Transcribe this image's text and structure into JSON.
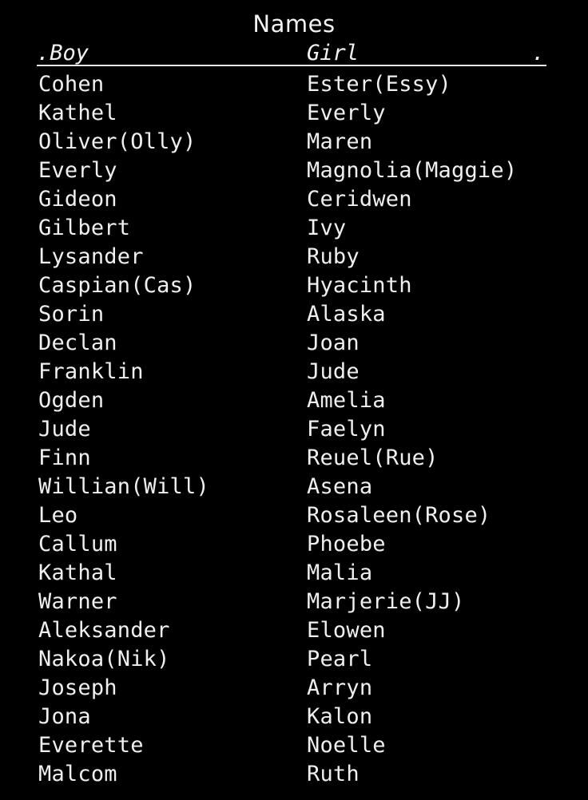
{
  "page": {
    "title": "Names",
    "background_color": "#000000",
    "text_color": "#efefef"
  },
  "table": {
    "headers": {
      "boy": ".Boy",
      "girl": "Girl",
      "trailing_mark": "."
    },
    "rows": [
      {
        "boy": "Cohen",
        "girl": "Ester(Essy)"
      },
      {
        "boy": "Kathel",
        "girl": "Everly"
      },
      {
        "boy": "Oliver(Olly)",
        "girl": "Maren"
      },
      {
        "boy": "Everly",
        "girl": "Magnolia(Maggie)"
      },
      {
        "boy": "Gideon",
        "girl": "Ceridwen"
      },
      {
        "boy": "Gilbert",
        "girl": "Ivy"
      },
      {
        "boy": "Lysander",
        "girl": "Ruby"
      },
      {
        "boy": "Caspian(Cas)",
        "girl": "Hyacinth"
      },
      {
        "boy": "Sorin",
        "girl": "Alaska"
      },
      {
        "boy": "Declan",
        "girl": "Joan"
      },
      {
        "boy": "Franklin",
        "girl": "Jude"
      },
      {
        "boy": "Ogden",
        "girl": "Amelia"
      },
      {
        "boy": "Jude",
        "girl": "Faelyn"
      },
      {
        "boy": "Finn",
        "girl": "Reuel(Rue)"
      },
      {
        "boy": "Willian(Will)",
        "girl": "Asena"
      },
      {
        "boy": "Leo",
        "girl": "Rosaleen(Rose)"
      },
      {
        "boy": "Callum",
        "girl": "Phoebe"
      },
      {
        "boy": "Kathal",
        "girl": "Malia"
      },
      {
        "boy": "Warner",
        "girl": "Marjerie(JJ)"
      },
      {
        "boy": "Aleksander",
        "girl": "Elowen"
      },
      {
        "boy": "Nakoa(Nik)",
        "girl": "Pearl"
      },
      {
        "boy": "Joseph",
        "girl": "Arryn"
      },
      {
        "boy": "Jona",
        "girl": "Kalon"
      },
      {
        "boy": "Everette",
        "girl": "Noelle"
      },
      {
        "boy": "Malcom",
        "girl": "Ruth"
      }
    ]
  }
}
